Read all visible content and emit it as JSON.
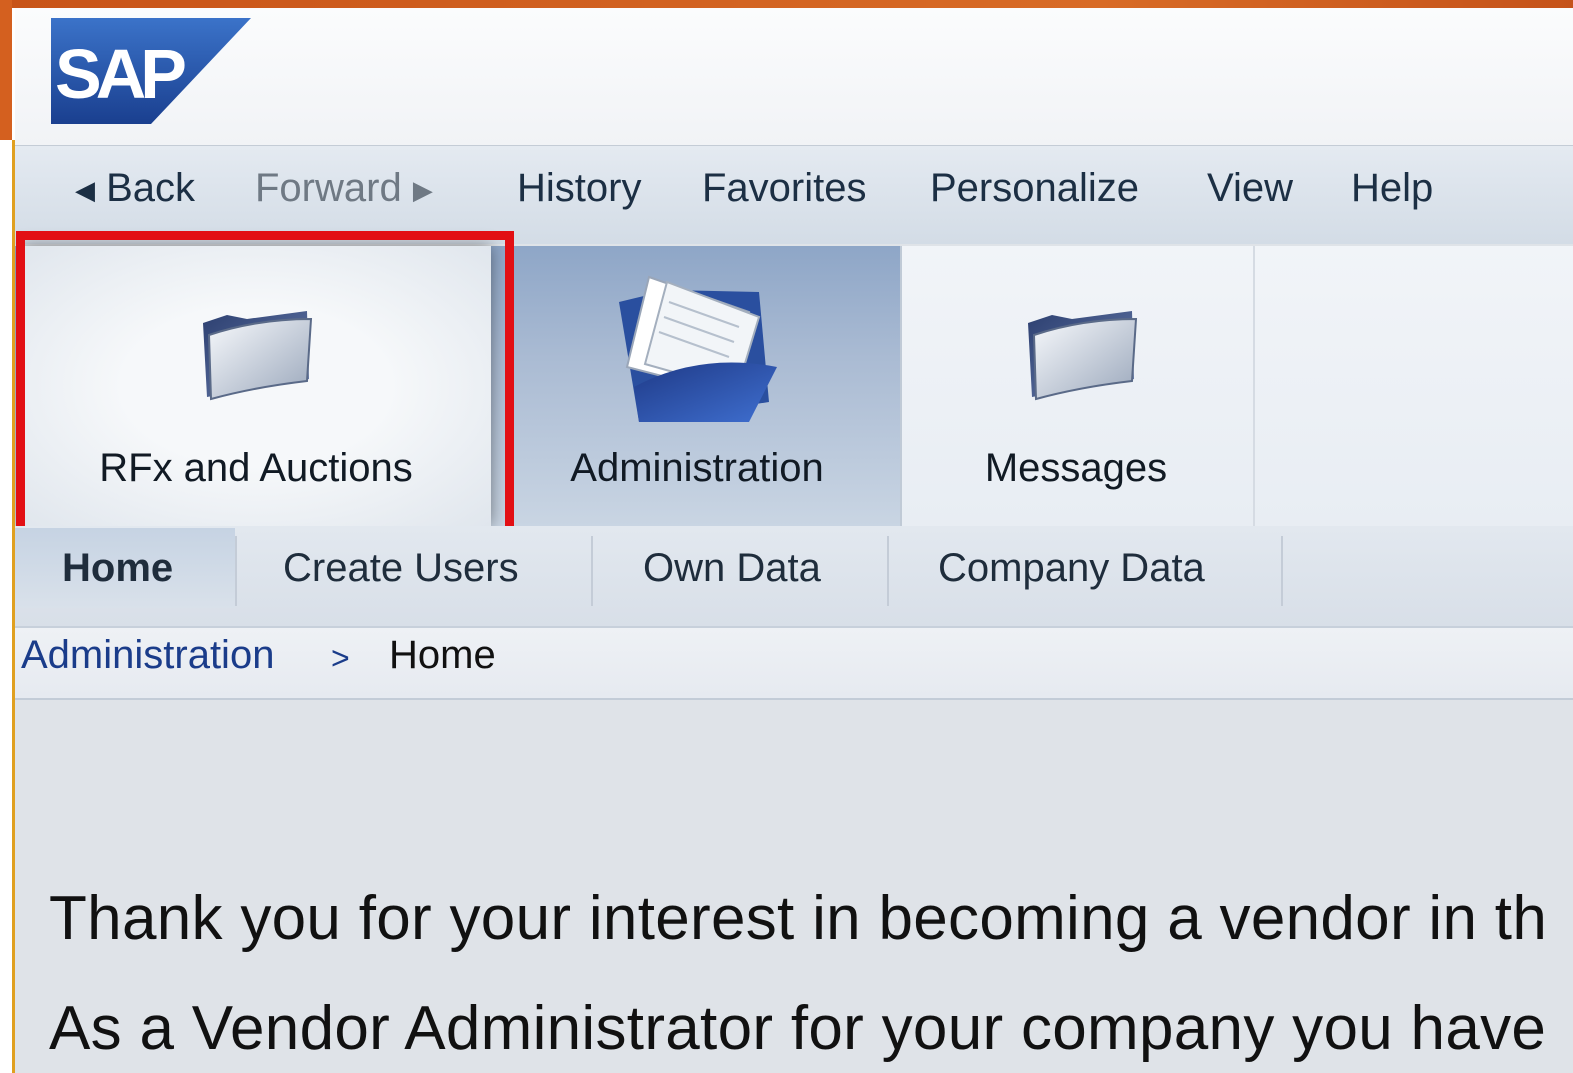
{
  "brand": {
    "logo_text": "SAP"
  },
  "menu": {
    "back": "Back",
    "forward": "Forward",
    "items": [
      "History",
      "Favorites",
      "Personalize",
      "View",
      "Help"
    ]
  },
  "nav_tiles": [
    {
      "label": "RFx and Auctions",
      "icon": "folder-icon",
      "highlighted": true
    },
    {
      "label": "Administration",
      "icon": "documents-folder-icon",
      "selected": true
    },
    {
      "label": "Messages",
      "icon": "folder-icon"
    }
  ],
  "sub_nav": [
    "Home",
    "Create Users",
    "Own Data",
    "Company Data"
  ],
  "breadcrumb": {
    "parent": "Administration",
    "separator": ">",
    "current": "Home"
  },
  "content": {
    "line1": "Thank you for your interest in becoming a vendor in th",
    "line2": "As a Vendor Administrator for your company you have"
  },
  "colors": {
    "highlight": "#e20f14",
    "link": "#1a3c8a",
    "frame": "#d4601f"
  }
}
